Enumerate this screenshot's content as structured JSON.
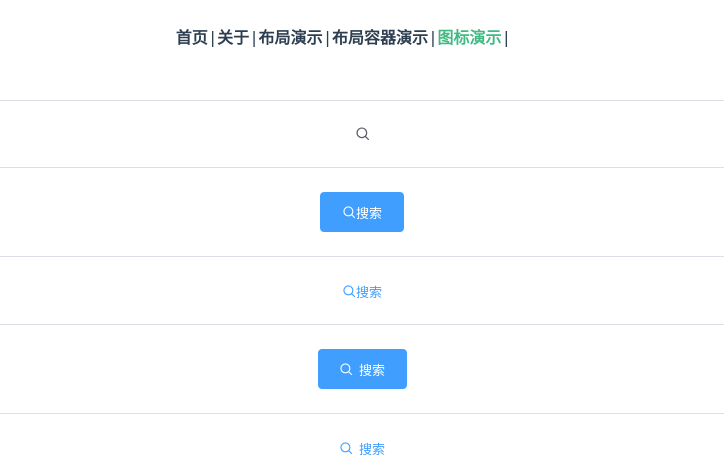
{
  "nav": {
    "items": [
      {
        "label": "首页"
      },
      {
        "label": "关于"
      },
      {
        "label": "布局演示"
      },
      {
        "label": "布局容器演示"
      },
      {
        "label": "图标演示"
      }
    ],
    "separator": "|",
    "active_index": 4
  },
  "demo": {
    "plain_icon": "search-icon",
    "button_compact": {
      "label": "搜索",
      "icon": "search-icon"
    },
    "text_button_compact": {
      "label": "搜索",
      "icon": "search-icon"
    },
    "button_spaced": {
      "label": "搜索",
      "icon": "search-icon"
    },
    "text_button_spaced": {
      "label": "搜索",
      "icon": "search-icon"
    }
  },
  "colors": {
    "primary": "#409eff",
    "nav_active": "#42b983",
    "text": "#2c3e50",
    "divider": "#dcdfe6"
  }
}
